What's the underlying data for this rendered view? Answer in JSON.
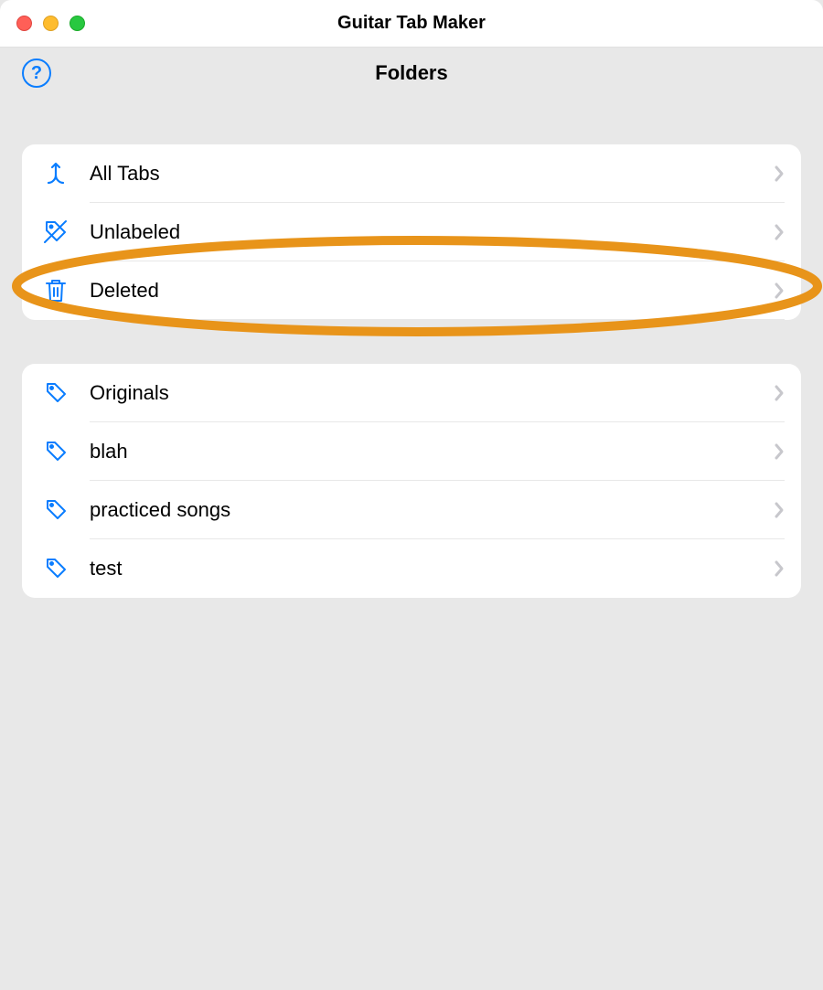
{
  "window": {
    "title": "Guitar Tab Maker"
  },
  "page": {
    "title": "Folders"
  },
  "system_folders": [
    {
      "icon": "merge",
      "label": "All Tabs"
    },
    {
      "icon": "tag-off",
      "label": "Unlabeled"
    },
    {
      "icon": "trash",
      "label": "Deleted"
    }
  ],
  "user_folders": [
    {
      "icon": "tag",
      "label": "Originals"
    },
    {
      "icon": "tag",
      "label": "blah"
    },
    {
      "icon": "tag",
      "label": "practiced songs"
    },
    {
      "icon": "tag",
      "label": "test"
    }
  ],
  "annotation": {
    "highlighted_row": "Deleted",
    "color": "#e8941a"
  },
  "help": {
    "glyph": "?"
  }
}
